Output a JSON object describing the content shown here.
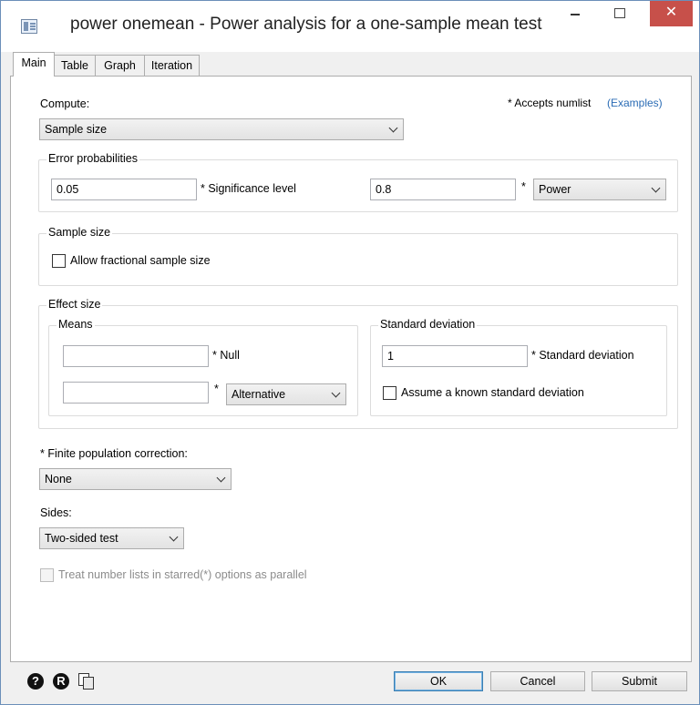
{
  "window": {
    "title": "power onemean - Power analysis for a one-sample mean test",
    "close_glyph": "✕",
    "app_icon": "table-dialog-icon"
  },
  "tabs": [
    "Main",
    "Table",
    "Graph",
    "Iteration"
  ],
  "main": {
    "compute_label": "Compute:",
    "compute_value": "Sample size",
    "numlist_note": "* Accepts numlist",
    "examples_link": "(Examples)",
    "error_prob": {
      "title": "Error probabilities",
      "alpha_value": "0.05",
      "alpha_label": "* Significance level",
      "power_value": "0.8",
      "power_star": "*",
      "power_select": "Power"
    },
    "sample_size": {
      "title": "Sample size",
      "fractional_label": "Allow fractional sample size",
      "fractional_checked": false
    },
    "effect_size": {
      "title": "Effect size",
      "means": {
        "title": "Means",
        "null_value": "",
        "null_label": "* Null",
        "alt_value": "",
        "alt_star": "*",
        "alt_select": "Alternative"
      },
      "sd": {
        "title": "Standard deviation",
        "sd_value": "1",
        "sd_label": "* Standard deviation",
        "known_label": "Assume a known standard deviation",
        "known_checked": false
      }
    },
    "fpc_label": "* Finite population correction:",
    "fpc_value": "None",
    "sides_label": "Sides:",
    "sides_value": "Two-sided test",
    "parallel_label": "Treat number lists in starred(*) options as parallel"
  },
  "footer": {
    "help_icon": "?",
    "reset_icon": "R",
    "ok": "OK",
    "cancel": "Cancel",
    "submit": "Submit"
  },
  "colors": {
    "close_button": "#c7504a",
    "link": "#2b6cb5",
    "default_button_border": "#3c7fb1"
  }
}
